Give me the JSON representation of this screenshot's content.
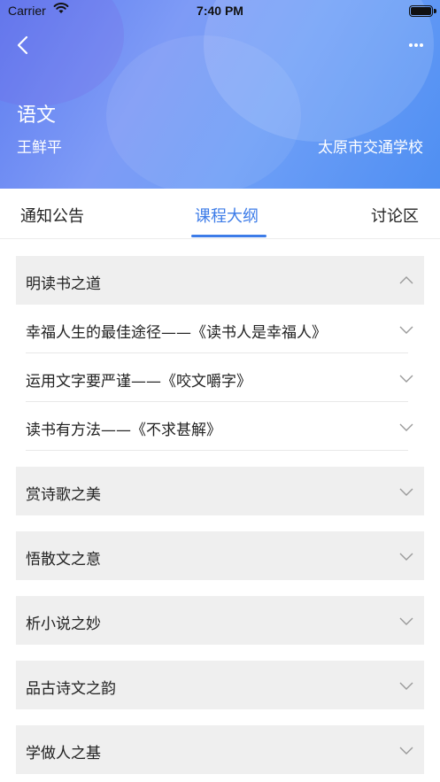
{
  "status_bar": {
    "carrier": "Carrier",
    "time": "7:40 PM"
  },
  "header": {
    "course_title": "语文",
    "teacher": "王鲜平",
    "school": "太原市交通学校",
    "back_icon": "chevron-left-icon",
    "more_icon": "more-dots-icon"
  },
  "tabs": [
    {
      "label": "通知公告",
      "active": false
    },
    {
      "label": "课程大纲",
      "active": true
    },
    {
      "label": "讨论区",
      "active": false
    }
  ],
  "colors": {
    "accent": "#3d7ce8",
    "chapter_bg": "#efefef"
  },
  "outline": {
    "chapters": [
      {
        "title": "明读书之道",
        "expanded": true,
        "lessons": [
          "幸福人生的最佳途径——《读书人是幸福人》",
          "运用文字要严谨——《咬文嚼字》",
          "读书有方法——《不求甚解》"
        ]
      },
      {
        "title": "赏诗歌之美",
        "expanded": false
      },
      {
        "title": "悟散文之意",
        "expanded": false
      },
      {
        "title": "析小说之妙",
        "expanded": false
      },
      {
        "title": "品古诗文之韵",
        "expanded": false
      },
      {
        "title": "学做人之基",
        "expanded": false
      }
    ]
  }
}
